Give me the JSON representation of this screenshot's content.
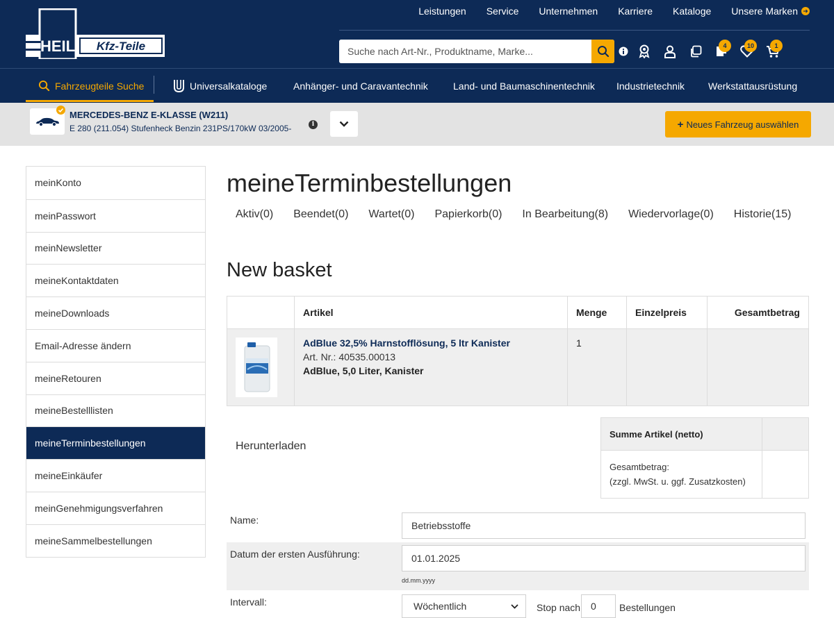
{
  "header": {
    "logo": {
      "left": "HEIL",
      "right": "Kfz-Teile"
    },
    "topnav": [
      "Leistungen",
      "Service",
      "Unternehmen",
      "Karriere",
      "Kataloge",
      "Unsere Marken"
    ],
    "search_placeholder": "Suche nach Art-Nr., Produktname, Marke...",
    "badges": {
      "notes": "4",
      "wishlist": "10",
      "cart": "1"
    }
  },
  "catnav": [
    "Fahrzeugteile Suche",
    "Universalkataloge",
    "Anhänger- und Caravantechnik",
    "Land- und Baumaschinentechnik",
    "Industrietechnik",
    "Werkstattausrüstung"
  ],
  "vehicle": {
    "title": "MERCEDES-BENZ E-KLASSE (W211)",
    "subtitle": "E 280 (211.054) Stufenheck Benzin 231PS/170kW 03/2005-",
    "new_button": "Neues Fahrzeug auswählen"
  },
  "sidebar": [
    "meinKonto",
    "meinPasswort",
    "meinNewsletter",
    "meineKontaktdaten",
    "meineDownloads",
    "Email-Adresse ändern",
    "meineRetouren",
    "meineBestelllisten",
    "meineTerminbestellungen",
    "meineEinkäufer",
    "meinGenehmigungsverfahren",
    "meineSammelbestellungen"
  ],
  "page": {
    "title": "meineTerminbestellungen",
    "tabs": [
      "Aktiv(0)",
      "Beendet(0)",
      "Wartet(0)",
      "Papierkorb(0)",
      "In Bearbeitung(8)",
      "Wiedervorlage(0)",
      "Historie(15)"
    ],
    "basket_title": "New basket"
  },
  "table": {
    "headers": [
      "",
      "Artikel",
      "Menge",
      "Einzelpreis",
      "Gesamtbetrag"
    ],
    "rows": [
      {
        "name": "AdBlue 32,5% Harnstofflösung, 5 ltr Kanister",
        "partno": "Art. Nr.: 40535.00013",
        "desc": "AdBlue, 5,0 Liter, Kanister",
        "qty": "1",
        "unit_price": "",
        "total": ""
      }
    ]
  },
  "download": "Herunterladen",
  "summary": {
    "header": "Summe Artikel (netto)",
    "line1": "Gesamtbetrag:",
    "line2": "(zzgl. MwSt. u. ggf. Zusatzkosten)"
  },
  "form": {
    "name_label": "Name:",
    "name_value": "Betriebsstoffe",
    "date_label": "Datum der ersten Ausführung:",
    "date_value": "01.01.2025",
    "date_hint": "dd.mm.yyyy",
    "interval_label": "Intervall:",
    "interval_value": "Wöchentlich",
    "stop_label": "Stop nach",
    "stop_value": "0",
    "stop_suffix": "Bestellungen"
  },
  "colors": {
    "navy": "#0d2a56",
    "accent": "#f5a800"
  }
}
